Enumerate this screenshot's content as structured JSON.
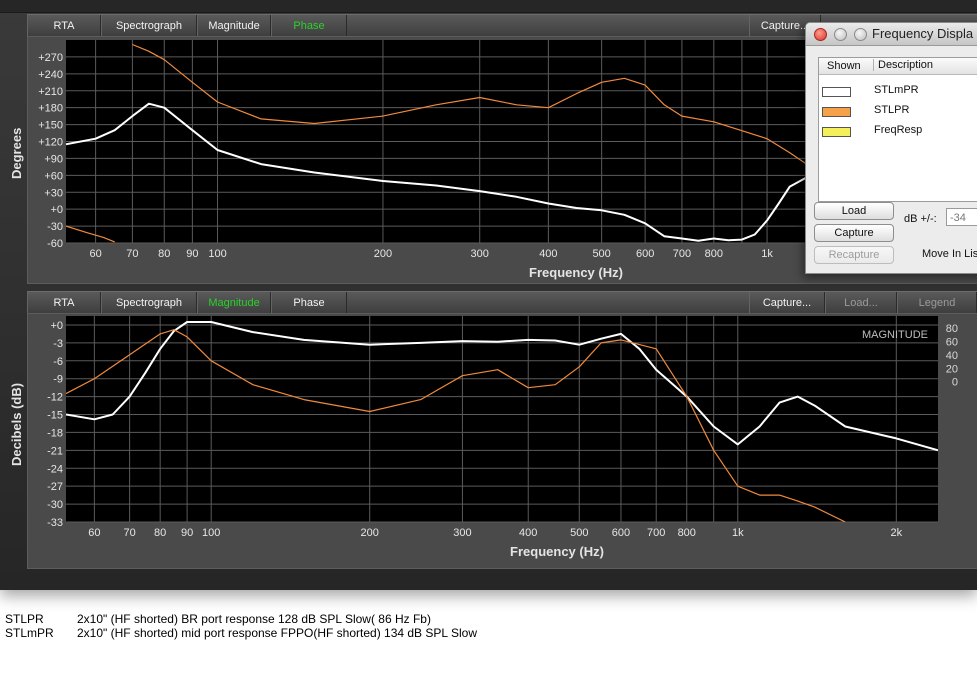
{
  "tabs_top": {
    "rta": "RTA",
    "spectrograph": "Spectrograph",
    "magnitude": "Magnitude",
    "phase": "Phase",
    "capture": "Capture..."
  },
  "tabs_bottom": {
    "rta": "RTA",
    "spectrograph": "Spectrograph",
    "magnitude": "Magnitude",
    "phase": "Phase",
    "capture": "Capture...",
    "load": "Load...",
    "legend": "Legend"
  },
  "colors": {
    "white_trace": "#ffffff",
    "orange_trace": "#f08a3c",
    "active_tab": "#2bd12b",
    "grid": "#5b5b5b"
  },
  "freq_window": {
    "title": "Frequency Displa",
    "col_shown": "Shown",
    "col_description": "Description",
    "items": [
      {
        "label": "STLmPR",
        "color": "#ffffff"
      },
      {
        "label": "STLPR",
        "color": "#f6a04a"
      },
      {
        "label": "FreqResp",
        "color": "#f5f05a"
      }
    ],
    "load": "Load",
    "capture": "Capture",
    "recapture": "Recapture",
    "db_label": "dB +/-:",
    "db_value": "-34",
    "move_label": "Move In Lis"
  },
  "captions": [
    {
      "name": "STLPR",
      "text": "2x10\" (HF shorted)  BR port response  128 dB SPL Slow( 86 Hz Fb)"
    },
    {
      "name": "STLmPR",
      "text": "2x10\" (HF shorted)  mid port response FPPO(HF shorted) 134 dB SPL Slow"
    }
  ],
  "chart_data": [
    {
      "type": "line",
      "title": "",
      "xlabel": "Frequency (Hz)",
      "ylabel": "Degrees",
      "x_scale": "log",
      "xlim": [
        53,
        2400
      ],
      "ylim": [
        -60,
        300
      ],
      "grid": true,
      "x_ticks": [
        {
          "v": 60,
          "l": "60"
        },
        {
          "v": 70,
          "l": "70"
        },
        {
          "v": 80,
          "l": "80"
        },
        {
          "v": 90,
          "l": "90"
        },
        {
          "v": 100,
          "l": "100"
        },
        {
          "v": 200,
          "l": "200"
        },
        {
          "v": 300,
          "l": "300"
        },
        {
          "v": 400,
          "l": "400"
        },
        {
          "v": 500,
          "l": "500"
        },
        {
          "v": 600,
          "l": "600"
        },
        {
          "v": 700,
          "l": "700"
        },
        {
          "v": 800,
          "l": "800"
        },
        {
          "v": 1000,
          "l": "1k"
        }
      ],
      "y_ticks": [
        {
          "v": 270,
          "l": "+270"
        },
        {
          "v": 240,
          "l": "+240"
        },
        {
          "v": 210,
          "l": "+210"
        },
        {
          "v": 180,
          "l": "+180"
        },
        {
          "v": 150,
          "l": "+150"
        },
        {
          "v": 120,
          "l": "+120"
        },
        {
          "v": 90,
          "l": "+90"
        },
        {
          "v": 60,
          "l": "+60"
        },
        {
          "v": 30,
          "l": "+30"
        },
        {
          "v": 0,
          "l": "+0"
        },
        {
          "v": -30,
          "l": "-30"
        },
        {
          "v": -60,
          "l": "-60"
        }
      ],
      "series": [
        {
          "name": "STLmPR",
          "color": "#ffffff",
          "width": 2,
          "x": [
            53,
            60,
            65,
            70,
            75,
            80,
            90,
            100,
            120,
            150,
            200,
            250,
            300,
            350,
            400,
            450,
            500,
            550,
            600,
            650,
            700,
            750,
            800,
            850,
            900,
            950,
            1000,
            1050,
            1100,
            1200,
            1300
          ],
          "y": [
            115,
            125,
            140,
            165,
            187,
            180,
            140,
            105,
            80,
            65,
            50,
            42,
            32,
            22,
            10,
            2,
            -2,
            -10,
            -25,
            -48,
            -52,
            -56,
            -52,
            -55,
            -54,
            -45,
            -20,
            10,
            40,
            60,
            55
          ]
        },
        {
          "name": "STLPR",
          "color": "#f08a3c",
          "width": 1.2,
          "x": [
            70,
            75,
            80,
            90,
            100,
            120,
            150,
            200,
            250,
            300,
            350,
            400,
            450,
            500,
            550,
            600,
            650,
            700,
            800,
            1000,
            1100,
            1200,
            1300,
            1350,
            1400
          ],
          "y": [
            292,
            280,
            265,
            225,
            190,
            160,
            152,
            165,
            185,
            198,
            185,
            180,
            205,
            225,
            232,
            220,
            185,
            165,
            155,
            125,
            100,
            75,
            60,
            90,
            120
          ]
        },
        {
          "name": "STLPR",
          "color": "#f08a3c",
          "width": 1.2,
          "x": [
            53,
            58,
            62,
            65
          ],
          "y": [
            -30,
            -42,
            -50,
            -58
          ]
        }
      ]
    },
    {
      "type": "line",
      "title": "",
      "xlabel": "Frequency (Hz)",
      "ylabel": "Decibels (dB)",
      "x_scale": "log",
      "xlim": [
        53,
        2400
      ],
      "ylim": [
        -33,
        1.5
      ],
      "grid": true,
      "annotation": "MAGNITUDE",
      "x_ticks": [
        {
          "v": 60,
          "l": "60"
        },
        {
          "v": 70,
          "l": "70"
        },
        {
          "v": 80,
          "l": "80"
        },
        {
          "v": 90,
          "l": "90"
        },
        {
          "v": 100,
          "l": "100"
        },
        {
          "v": 200,
          "l": "200"
        },
        {
          "v": 300,
          "l": "300"
        },
        {
          "v": 400,
          "l": "400"
        },
        {
          "v": 500,
          "l": "500"
        },
        {
          "v": 600,
          "l": "600"
        },
        {
          "v": 700,
          "l": "700"
        },
        {
          "v": 800,
          "l": "800"
        },
        {
          "v": 1000,
          "l": "1k"
        },
        {
          "v": 2000,
          "l": "2k"
        }
      ],
      "y_ticks": [
        {
          "v": 0,
          "l": "+0"
        },
        {
          "v": -3,
          "l": "-3"
        },
        {
          "v": -6,
          "l": "-6"
        },
        {
          "v": -9,
          "l": "-9"
        },
        {
          "v": -12,
          "l": "-12"
        },
        {
          "v": -15,
          "l": "-15"
        },
        {
          "v": -18,
          "l": "-18"
        },
        {
          "v": -21,
          "l": "-21"
        },
        {
          "v": -24,
          "l": "-24"
        },
        {
          "v": -27,
          "l": "-27"
        },
        {
          "v": -30,
          "l": "-30"
        },
        {
          "v": -33,
          "l": "-33"
        }
      ],
      "right_ticks": [
        {
          "v": -0.5,
          "l": "80"
        },
        {
          "v": -2.8,
          "l": "60"
        },
        {
          "v": -5,
          "l": "40"
        },
        {
          "v": -7.3,
          "l": "20"
        },
        {
          "v": -9.5,
          "l": "0"
        }
      ],
      "right_ticks_note": "right tick values shown for reference",
      "series": [
        {
          "name": "STLmPR",
          "color": "#ffffff",
          "width": 2,
          "x": [
            53,
            60,
            65,
            70,
            75,
            80,
            85,
            90,
            100,
            120,
            150,
            200,
            250,
            300,
            350,
            400,
            450,
            500,
            550,
            600,
            650,
            700,
            800,
            900,
            1000,
            1100,
            1200,
            1300,
            1400,
            1600,
            2000,
            2400
          ],
          "y": [
            -15,
            -15.8,
            -15,
            -12,
            -8,
            -4,
            -1,
            0.5,
            0.5,
            -1.2,
            -2.5,
            -3.3,
            -3,
            -2.7,
            -2.8,
            -2.5,
            -2.6,
            -3.3,
            -2.3,
            -1.5,
            -4,
            -7.5,
            -12,
            -17,
            -20,
            -17,
            -13,
            -12,
            -13.5,
            -17,
            -19,
            -21
          ]
        },
        {
          "name": "STLPR",
          "color": "#f08a3c",
          "width": 1.2,
          "x": [
            53,
            60,
            70,
            80,
            85,
            90,
            100,
            120,
            150,
            200,
            250,
            300,
            350,
            400,
            450,
            500,
            550,
            600,
            700,
            800,
            900,
            1000,
            1100,
            1200,
            1300,
            1400,
            1600
          ],
          "y": [
            -11.5,
            -9,
            -5,
            -1.5,
            -0.8,
            -2,
            -6,
            -10,
            -12.5,
            -14.5,
            -12.5,
            -8.5,
            -7.5,
            -10.5,
            -10,
            -7,
            -3,
            -2.5,
            -4,
            -12,
            -21,
            -27,
            -28.5,
            -28.5,
            -29.5,
            -30.5,
            -33
          ]
        }
      ]
    }
  ],
  "axis_title": "Frequency (Hz)",
  "ytitle_top": "Degrees",
  "ytitle_bottom": "Decibels (dB)",
  "magnitude_label": "MAGNITUDE"
}
